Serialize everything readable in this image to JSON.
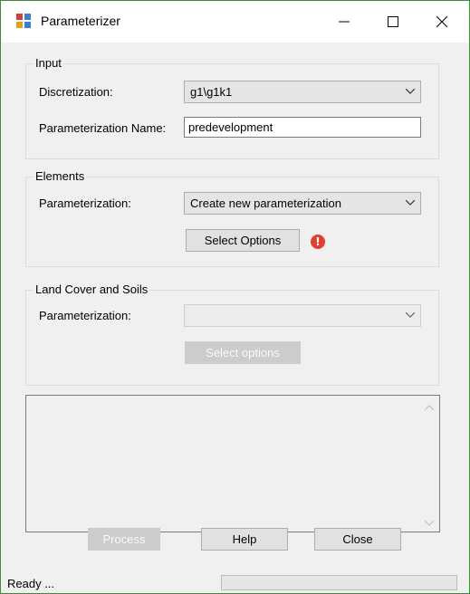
{
  "window": {
    "title": "Parameterizer",
    "controls": {
      "minimize_icon": "minimize-icon",
      "maximize_icon": "maximize-icon",
      "close_icon": "close-icon"
    }
  },
  "input": {
    "legend": "Input",
    "discretization_label": "Discretization:",
    "discretization_value": "g1\\g1k1",
    "param_name_label": "Parameterization Name:",
    "param_name_value": "predevelopment"
  },
  "elements": {
    "legend": "Elements",
    "param_label": "Parameterization:",
    "param_value": "Create new parameterization",
    "select_options_label": "Select Options",
    "warning_glyph": "!"
  },
  "landcover": {
    "legend": "Land Cover and Soils",
    "param_label": "Parameterization:",
    "param_value": "",
    "select_options_label": "Select options"
  },
  "footer": {
    "process_label": "Process",
    "help_label": "Help",
    "close_label": "Close"
  },
  "status": {
    "text": "Ready ...",
    "progress": 0
  },
  "colors": {
    "window_border": "#3c8c3c",
    "warning": "#e0402c"
  }
}
